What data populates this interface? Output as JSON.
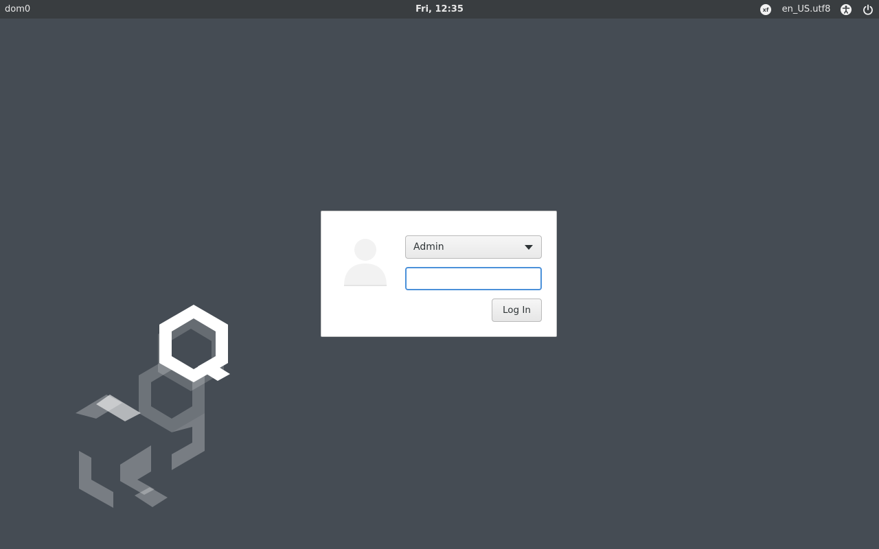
{
  "topbar": {
    "hostname": "dom0",
    "clock": "Fri, 12:35",
    "keyboard_layout_badge": "xf",
    "locale": "en_US.utf8",
    "icons": [
      "xfce-session-icon",
      "accessibility-icon",
      "power-icon"
    ]
  },
  "login": {
    "selected_user": "Admin",
    "password_value": "",
    "login_button_label": "Log In"
  },
  "colors": {
    "background": "#454c54",
    "topbar": "#393d40",
    "dialog": "#ffffff",
    "focus_accent": "#4a90d9"
  }
}
